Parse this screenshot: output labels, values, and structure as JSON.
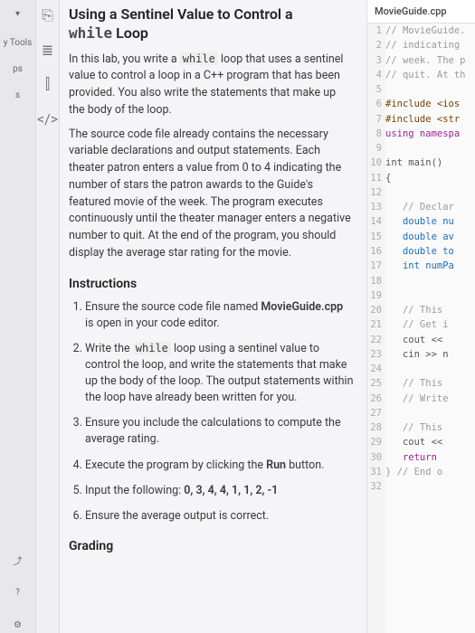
{
  "leftRail": {
    "collapse": "▾",
    "tools": "y Tools",
    "ps": "ps",
    "s": "s",
    "share": "⤴",
    "help": "?",
    "settings": "⚙"
  },
  "midRail": {
    "book": "⎘",
    "list": "≣",
    "chart": "⫿",
    "code": "</>"
  },
  "title_part1": "Using a Sentinel Value to Control a",
  "title_part2_kw": "while",
  "title_part2_rest": "Loop",
  "intro_a": "In this lab, you write a ",
  "intro_kw": "while",
  "intro_b": " loop that uses a sentinel value to control a loop in a C++ program that has been provided. You also write the statements that make up the body of the loop.",
  "para2": "The source code file already contains the necessary variable declarations and output statements. Each theater patron enters a value from 0 to 4 indicating the number of stars the patron awards to the Guide's featured movie of the week. The program executes continuously until the theater manager enters a negative number to quit. At the end of the program, you should display the average star rating for the movie.",
  "instr_heading": "Instructions",
  "step1_a": "Ensure the source code file named ",
  "step1_file": "MovieGuide.cpp",
  "step1_b": " is open in your code editor.",
  "step2_a": "Write the ",
  "step2_kw": "while",
  "step2_b": " loop using a sentinel value to control the loop, and write the statements that make up the body of the loop. The output statements within the loop have already been written for you.",
  "step3": "Ensure you include the calculations to compute the average rating.",
  "step4_a": "Execute the program by clicking the ",
  "step4_run": "Run",
  "step4_b": " button.",
  "step5_a": "Input the following: ",
  "step5_input": "0, 3, 4, 4, 1, 1, 2, -1",
  "step6": "Ensure the average output is correct.",
  "grading_heading": "Grading",
  "editor": {
    "filename": "MovieGuide.cpp",
    "lines": [
      {
        "n": 1,
        "cls": "tok-comment",
        "t": "// MovieGuide."
      },
      {
        "n": 2,
        "cls": "tok-comment",
        "t": "// indicating"
      },
      {
        "n": 3,
        "cls": "tok-comment",
        "t": "// week. The p"
      },
      {
        "n": 4,
        "cls": "tok-comment",
        "t": "// quit. At th"
      },
      {
        "n": 5,
        "cls": "",
        "t": ""
      },
      {
        "n": 6,
        "cls": "tok-pre",
        "t": "#include <ios"
      },
      {
        "n": 7,
        "cls": "tok-pre",
        "t": "#include <str"
      },
      {
        "n": 8,
        "cls": "tok-keyword",
        "t": "using namespa"
      },
      {
        "n": 9,
        "cls": "",
        "t": ""
      },
      {
        "n": 10,
        "cls": "",
        "t": "int main()"
      },
      {
        "n": 11,
        "cls": "",
        "t": "{"
      },
      {
        "n": 12,
        "cls": "",
        "t": ""
      },
      {
        "n": 13,
        "cls": "tok-comment",
        "t": "   // Declar"
      },
      {
        "n": 14,
        "cls": "tok-type",
        "t": "   double nu"
      },
      {
        "n": 15,
        "cls": "tok-type",
        "t": "   double av"
      },
      {
        "n": 16,
        "cls": "tok-type",
        "t": "   double to"
      },
      {
        "n": 17,
        "cls": "tok-type",
        "t": "   int numPa"
      },
      {
        "n": 18,
        "cls": "",
        "t": ""
      },
      {
        "n": 19,
        "cls": "",
        "t": ""
      },
      {
        "n": 20,
        "cls": "tok-comment",
        "t": "   // This "
      },
      {
        "n": 21,
        "cls": "tok-comment",
        "t": "   // Get i"
      },
      {
        "n": 22,
        "cls": "",
        "t": "   cout <<"
      },
      {
        "n": 23,
        "cls": "",
        "t": "   cin >> n"
      },
      {
        "n": 24,
        "cls": "",
        "t": ""
      },
      {
        "n": 25,
        "cls": "tok-comment",
        "t": "   // This"
      },
      {
        "n": 26,
        "cls": "tok-comment",
        "t": "   // Write"
      },
      {
        "n": 27,
        "cls": "",
        "t": ""
      },
      {
        "n": 28,
        "cls": "tok-comment",
        "t": "   // This"
      },
      {
        "n": 29,
        "cls": "",
        "t": "   cout <<"
      },
      {
        "n": 30,
        "cls": "tok-keyword",
        "t": "   return"
      },
      {
        "n": 31,
        "cls": "tok-comment",
        "t": "} // End o"
      },
      {
        "n": 32,
        "cls": "",
        "t": ""
      }
    ]
  }
}
